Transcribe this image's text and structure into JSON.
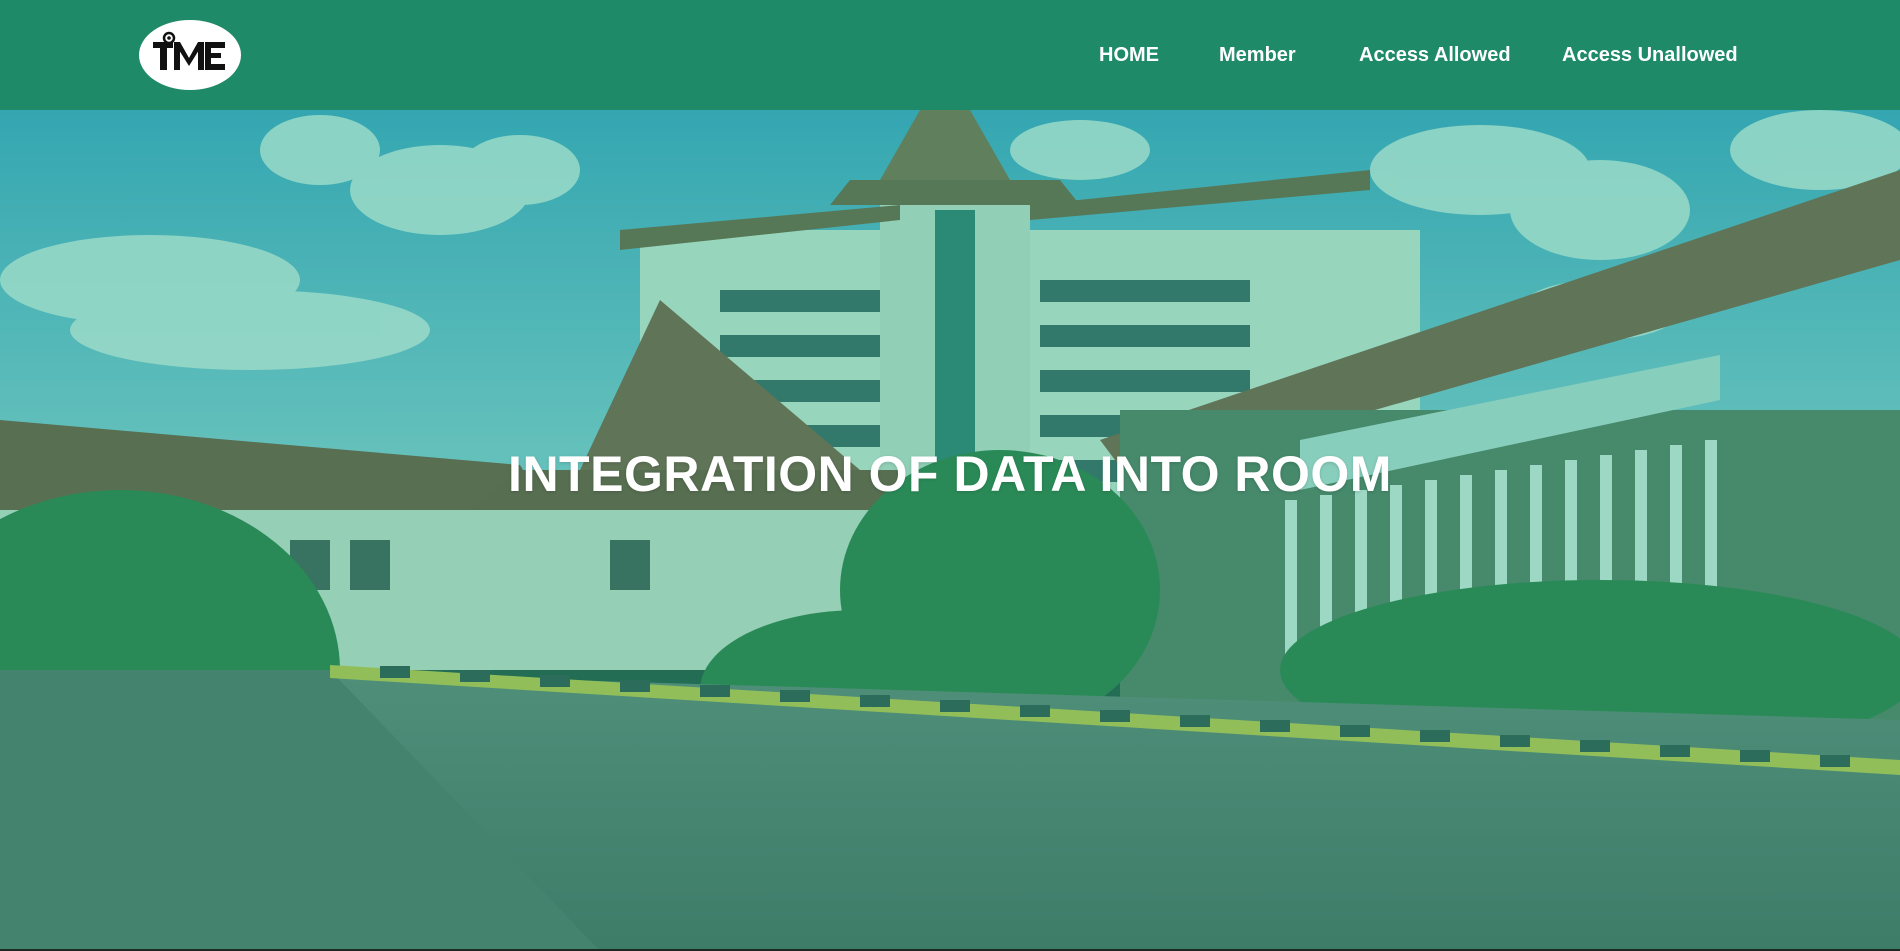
{
  "header": {
    "logo_text": "TME",
    "nav": [
      {
        "label": "HOME"
      },
      {
        "label": "Member"
      },
      {
        "label": "Access Allowed"
      },
      {
        "label": "Access Unallowed"
      }
    ]
  },
  "hero": {
    "title": "INTEGRATION OF DATA INTO ROOM"
  },
  "colors": {
    "navbar": "#1f8a67",
    "overlay": "#26b487",
    "text": "#ffffff"
  }
}
